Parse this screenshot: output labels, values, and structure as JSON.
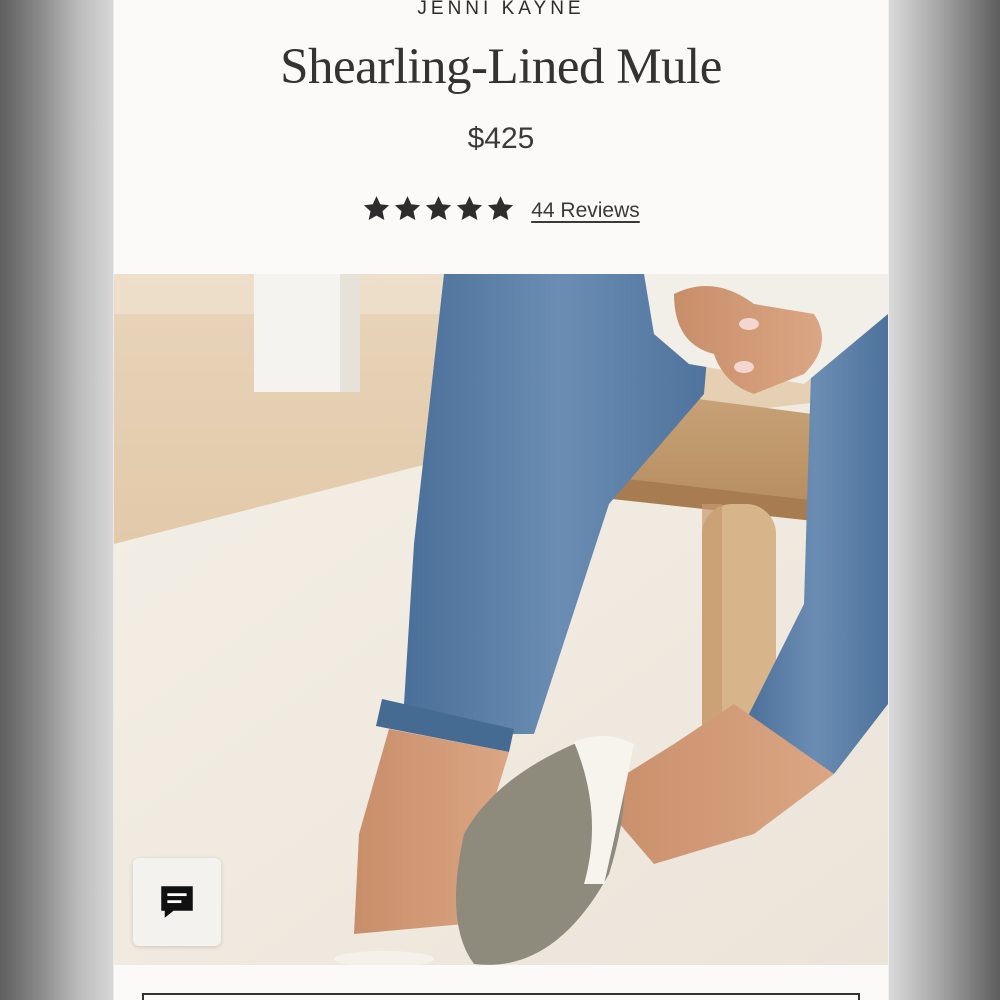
{
  "product": {
    "brand": "JENNI KAYNE",
    "title": "Shearling-Lined Mule",
    "price": "$425",
    "rating": 5,
    "reviews_label": "44 Reviews"
  },
  "hero": {
    "alt": "Product photo"
  },
  "chat": {
    "icon": "chat-icon"
  },
  "colors": {
    "page_bg": "#fbfaf8",
    "text": "#333333",
    "star": "#2d2d2d"
  }
}
